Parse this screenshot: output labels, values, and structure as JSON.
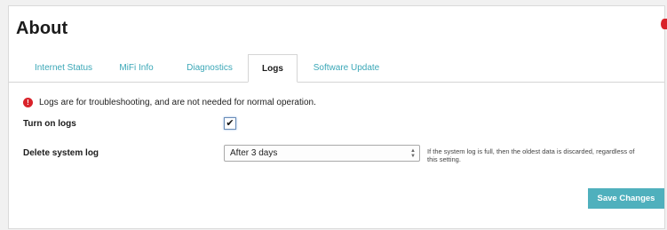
{
  "header": {
    "title": "About"
  },
  "tabs": [
    {
      "label": "Internet Status",
      "active": false
    },
    {
      "label": "MiFi Info",
      "active": false
    },
    {
      "label": "Diagnostics",
      "active": false
    },
    {
      "label": "Logs",
      "active": true
    },
    {
      "label": "Software Update",
      "active": false
    }
  ],
  "notice": {
    "icon": "info-icon",
    "icon_glyph": "!",
    "text": "Logs are for troubleshooting, and are not needed for normal operation."
  },
  "logs_toggle": {
    "label": "Turn on logs",
    "checked": true,
    "check_glyph": "✔"
  },
  "delete_log": {
    "label": "Delete system log",
    "selected_value": "After 3 days",
    "help_text": "If the system log is full, then the oldest data is discarded, regardless of this setting."
  },
  "actions": {
    "save_label": "Save Changes"
  },
  "colors": {
    "accent": "#4fb0bd",
    "tab_link": "#3aa7b7",
    "alert": "#d9222a"
  }
}
